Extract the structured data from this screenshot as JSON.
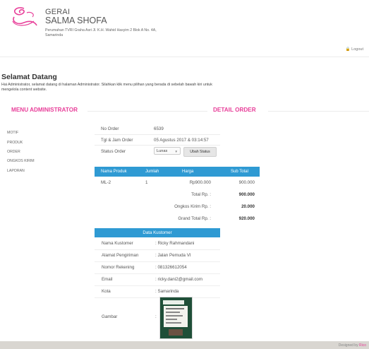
{
  "brand": {
    "line1": "GERAI",
    "line2": "SALMA SHOFA",
    "address_line1": "Perumahan TVRI Graha Asri Jl. K.H. Wahid Hasyim 2 Blok A No. 4A,",
    "address_line2": "Samarinda",
    "accent_color": "#e8409a"
  },
  "header": {
    "logout_icon": "lock-icon",
    "logout_label": "Logout"
  },
  "welcome": {
    "title": "Selamat Datang",
    "intro_line1": "Hai Administrator, selamat datang di halaman Administrator. Silahkan klik menu pilihan yang berada di sebelah bawah kiri untuk",
    "intro_line2": "mengelola content website."
  },
  "sidebar": {
    "title": "MENU ADMINISTRATOR",
    "items": [
      {
        "label": "MOTIF"
      },
      {
        "label": "PRODUK"
      },
      {
        "label": "ORDER"
      },
      {
        "label": "ONGKOS KIRIM"
      },
      {
        "label": "LAPORAN"
      }
    ]
  },
  "detail": {
    "title": "DETAIL ORDER",
    "no_order_label": "No Order",
    "no_order_value": "6539",
    "date_label": "Tgl & Jam Order",
    "date_value": "05 Agustus 2017 & 03:14:57",
    "status_label": "Status Order",
    "status_value": "Lunas",
    "change_status_button": "Ubah Status"
  },
  "products": {
    "header_color": "#2f9ad3",
    "columns": [
      "Nama Produk",
      "Jumlah",
      "Harga",
      "Sub Total"
    ],
    "rows": [
      {
        "nama": "ML-2",
        "jumlah": "1",
        "harga": "Rp900.000",
        "subtotal": "900.000"
      }
    ],
    "total_label": "Total Rp. :",
    "total_value": "900.000",
    "ongkos_label": "Ongkos Kirim Rp. :",
    "ongkos_value": "20.000",
    "grand_label": "Grand Total Rp. :",
    "grand_value": "920.000"
  },
  "customer": {
    "title": "Data Kustomer",
    "rows": [
      {
        "label": "Nama Kustomer",
        "value": ": Ricky Rahmandani"
      },
      {
        "label": "Alamat Pengiriman",
        "value": ": Jalan Pemuda VI"
      },
      {
        "label": "Nomor Rekening",
        "value": ": 081326612054"
      },
      {
        "label": "Email",
        "value": ": ricky.dani2@gmail.com"
      },
      {
        "label": "Kota",
        "value": ": Samarinda"
      }
    ],
    "image_label": "Gambar",
    "image_value": ":"
  },
  "footer": {
    "designed_by": "Designed by",
    "designer": "Rico"
  }
}
